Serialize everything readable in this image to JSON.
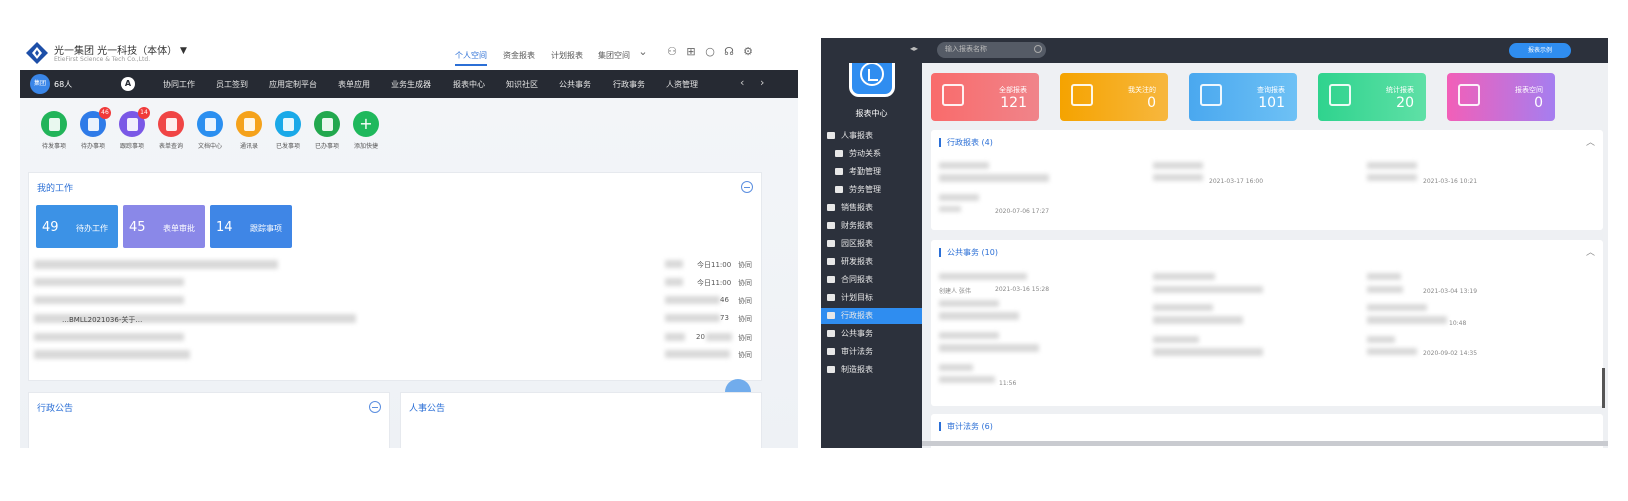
{
  "left": {
    "company": "光一集团  光一科技（本体）",
    "company_sub": "EtieFirst Science & Tech Co.,Ltd.",
    "top_tabs": [
      "个人空间",
      "资金报表",
      "计划报表",
      "集团空间"
    ],
    "top_tab_active": 0,
    "top_icons": [
      "user-icon",
      "apps-icon",
      "search-icon",
      "service-icon",
      "settings-icon"
    ],
    "nav": {
      "avatar": "集团",
      "user": "68人",
      "a_label": "A",
      "items": [
        "协同工作",
        "员工签到",
        "应用定制平台",
        "表单应用",
        "业务生成器",
        "报表中心",
        "知识社区",
        "公共事务",
        "行政事务",
        "人资管理"
      ]
    },
    "quick_items": [
      {
        "label": "待发事项",
        "color": "#22b45a",
        "badge": ""
      },
      {
        "label": "待办事项",
        "color": "#2f7be8",
        "badge": "46"
      },
      {
        "label": "跟踪事项",
        "color": "#7a58e6",
        "badge": "14"
      },
      {
        "label": "表单查询",
        "color": "#f04545",
        "badge": ""
      },
      {
        "label": "文档中心",
        "color": "#2b8ff0",
        "badge": ""
      },
      {
        "label": "通讯录",
        "color": "#f5a21b",
        "badge": ""
      },
      {
        "label": "已发事项",
        "color": "#1aa9e8",
        "badge": ""
      },
      {
        "label": "已办事项",
        "color": "#22a84e",
        "badge": ""
      },
      {
        "label": "添加快捷",
        "color": "#1fb85c",
        "badge": "+"
      }
    ],
    "work": {
      "title": "我的工作",
      "stats": [
        {
          "num": "49",
          "label": "待办工作",
          "color": "#3c92e6"
        },
        {
          "num": "45",
          "label": "表单审批",
          "color": "#8a88e8"
        },
        {
          "num": "14",
          "label": "跟踪事项",
          "color": "#3f86e6"
        }
      ],
      "partial_text": "…BMLL2021036-关于…",
      "rows": [
        {
          "time": "今日11:00",
          "tag": "协同"
        },
        {
          "time": "今日11:00",
          "tag": "协同"
        },
        {
          "time": "46",
          "tag": "协同"
        },
        {
          "time": "73",
          "tag": "协同"
        },
        {
          "time": "20",
          "tag": "协同"
        },
        {
          "time": "",
          "tag": "协同"
        }
      ]
    },
    "admin_notice": "行政公告",
    "hr_notice": "人事公告"
  },
  "right": {
    "center_title": "报表中心",
    "search_placeholder": "输入报表名称",
    "example_label": "报表示例",
    "sidebar": [
      {
        "label": "人事报表",
        "sub": false,
        "active": false
      },
      {
        "label": "劳动关系",
        "sub": true,
        "active": false
      },
      {
        "label": "考勤管理",
        "sub": true,
        "active": false
      },
      {
        "label": "劳务管理",
        "sub": true,
        "active": false
      },
      {
        "label": "销售报表",
        "sub": false,
        "active": false
      },
      {
        "label": "财务报表",
        "sub": false,
        "active": false
      },
      {
        "label": "园区报表",
        "sub": false,
        "active": false
      },
      {
        "label": "研发报表",
        "sub": false,
        "active": false
      },
      {
        "label": "合同报表",
        "sub": false,
        "active": false
      },
      {
        "label": "计划目标",
        "sub": false,
        "active": false
      },
      {
        "label": "行政报表",
        "sub": false,
        "active": true
      },
      {
        "label": "公共事务",
        "sub": false,
        "active": false
      },
      {
        "label": "审计法务",
        "sub": false,
        "active": false
      },
      {
        "label": "制造报表",
        "sub": false,
        "active": false
      }
    ],
    "tiles": [
      {
        "label": "全部报表",
        "num": "121",
        "color1": "#f96b6b",
        "color2": "#f0848a"
      },
      {
        "label": "我关注的",
        "num": "0",
        "color1": "#f5a300",
        "color2": "#f7b73e"
      },
      {
        "label": "查询报表",
        "num": "101",
        "color1": "#4aa8ef",
        "color2": "#6ec1f5"
      },
      {
        "label": "统计报表",
        "num": "20",
        "color1": "#2fd38e",
        "color2": "#5fe0a6"
      },
      {
        "label": "报表空间",
        "num": "0",
        "color1": "#f25fb8",
        "color2": "#a57ef0"
      }
    ],
    "sections": [
      {
        "title": "行政报表 (4)",
        "times": [
          "2021-03-17 16:00",
          "2021-03-16 10:21",
          "2020-07-06 17:27"
        ]
      },
      {
        "title": "公共事务 (10)",
        "times": [
          "2021-03-04 13:19",
          "10:48",
          "2020-09-02 14:35",
          "11:56"
        ]
      },
      {
        "title": "审计法务 (6)"
      }
    ],
    "misc_text": [
      "创建人 张伟",
      "2021-03-16 15:28"
    ]
  }
}
